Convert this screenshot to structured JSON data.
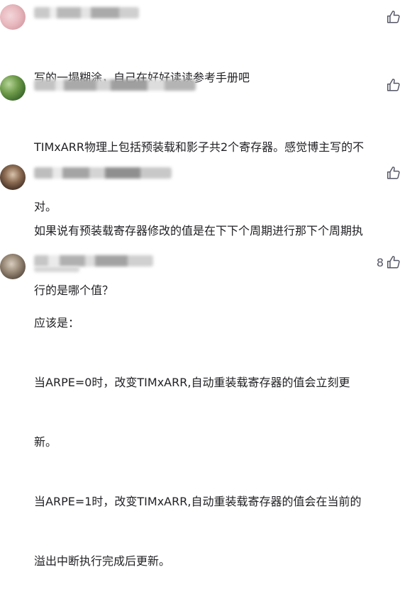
{
  "comments": [
    {
      "text_lines": [
        "写的一塌糊涂，自己在好好读读参考手册吧"
      ],
      "like_count": ""
    },
    {
      "text_lines": [
        "TIMxARR物理上包括预装载和影子共2个寄存器。感觉博主写的不",
        "对。"
      ],
      "like_count": ""
    },
    {
      "text_lines": [
        "如果说有预装载寄存器修改的值是在下下个周期进行那下个周期执",
        "行的是哪个值？"
      ],
      "like_count": ""
    },
    {
      "text_lines": [
        "应该是：",
        "当ARPE=0时，改变TIMxARR,自动重装载寄存器的值会立刻更",
        "新。",
        "当ARPE=1时，改变TIMxARR,自动重装载寄存器的值会在当前的",
        "溢出中断执行完成后更新。"
      ],
      "like_count": "8"
    }
  ],
  "colors": {
    "text": "#222226",
    "icon": "#555666"
  },
  "icons": {
    "like": "thumbs-up-icon"
  }
}
